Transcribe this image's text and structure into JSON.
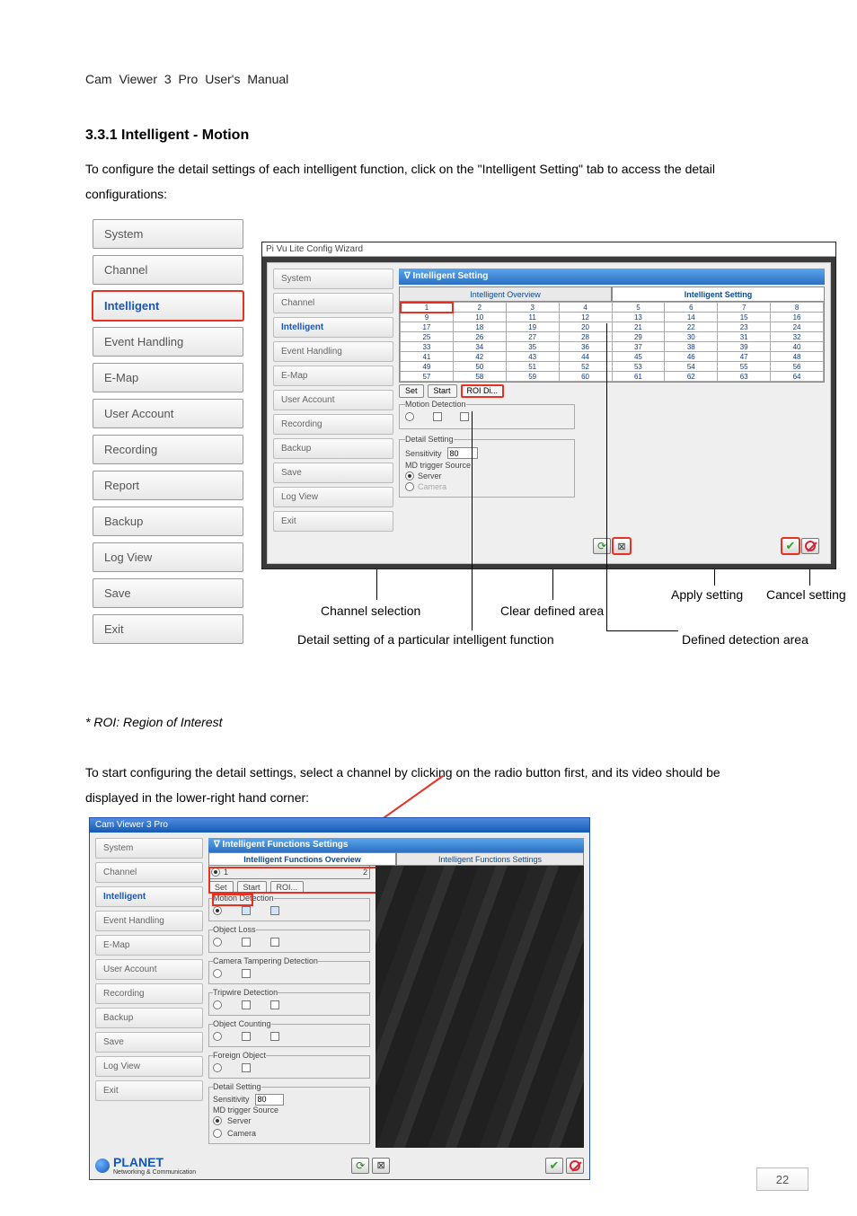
{
  "running_header": "Cam  Viewer  3  Pro  User's  Manual",
  "section_title": "3.3.1 Intelligent - Motion",
  "paragraph1": "To configure the detail settings of each intelligent function, click on the \"Intelligent Setting\" tab to access the detail configurations:",
  "roi_note": "* ROI: Region of Interest",
  "paragraph2": "To start configuring the detail settings, select a channel by clicking on the radio button first, and its video should be displayed in the lower-right hand corner:",
  "page_number": "22",
  "left_menu": {
    "items": [
      "System",
      "Channel",
      "Intelligent",
      "Event Handling",
      "E-Map",
      "User Account",
      "Recording",
      "Report",
      "Backup",
      "Log View",
      "Save",
      "Exit"
    ],
    "active_index": 2,
    "outlined_index": 2
  },
  "mini_menu": {
    "items": [
      "System",
      "Channel",
      "Intelligent",
      "Event Handling",
      "E-Map",
      "User Account",
      "Recording",
      "Backup",
      "Save",
      "Log View",
      "Exit"
    ],
    "active_index": 2
  },
  "wizard": {
    "window_title": "Pi Vu Lite Config Wizard",
    "panel_title": "∇ Intelligent Setting",
    "tabs": {
      "left": "Intelligent Overview",
      "right": "Intelligent Setting",
      "active": "right"
    },
    "channel_grid": {
      "cols": 8,
      "rows": 8,
      "values": [
        [
          1,
          2,
          3,
          4,
          5,
          6,
          7,
          8
        ],
        [
          9,
          10,
          11,
          12,
          13,
          14,
          15,
          16
        ],
        [
          17,
          18,
          19,
          20,
          21,
          22,
          23,
          24
        ],
        [
          25,
          26,
          27,
          28,
          29,
          30,
          31,
          32
        ],
        [
          33,
          34,
          35,
          36,
          37,
          38,
          39,
          40
        ],
        [
          41,
          42,
          43,
          44,
          45,
          46,
          47,
          48
        ],
        [
          49,
          50,
          51,
          52,
          53,
          54,
          55,
          56
        ],
        [
          57,
          58,
          59,
          60,
          61,
          62,
          63,
          64
        ]
      ],
      "outlined_cell": [
        0,
        0
      ]
    },
    "buttons": {
      "set": "Set",
      "start": "Start",
      "roi": "ROI Di..."
    },
    "motion_detection_label": "Motion Detection",
    "detail_setting": {
      "legend": "Detail Setting",
      "sensitivity_label": "Sensitivity",
      "sensitivity_value": "80",
      "trigger_label": "MD trigger Source",
      "server_label": "Server",
      "camera_label": "Camera"
    },
    "callouts": {
      "channel_selection": "Channel selection",
      "clear_defined_area": "Clear defined area",
      "apply_setting": "Apply setting",
      "cancel_setting": "Cancel setting",
      "detail_particular": "Detail setting of a particular intelligent function",
      "defined_area": "Defined detection area"
    }
  },
  "dialog2": {
    "title": "Cam Viewer 3 Pro",
    "panel_title": "∇ Intelligent Functions Settings",
    "tabs": {
      "left": "Intelligent Functions Overview",
      "right": "Intelligent Functions Settings",
      "active": "left"
    },
    "channels": [
      "1",
      "2"
    ],
    "row2_buttons": {
      "set": "Set",
      "start": "Start",
      "roi": "ROI..."
    },
    "blocks": {
      "motion": {
        "label": "Motion Detection",
        "radio": true,
        "check1": true,
        "check2": true
      },
      "loss": {
        "label": "Object Loss",
        "radio": false,
        "check1": false,
        "check2": false
      },
      "tamper": {
        "label": "Camera Tampering Detection",
        "radio": false,
        "check1": false
      },
      "trip": {
        "label": "Tripwire Detection",
        "radio": false,
        "check1": false,
        "check2": false
      },
      "count": {
        "label": "Object Counting",
        "radio": false,
        "check1": false,
        "check2": false
      },
      "foreign": {
        "label": "Foreign Object",
        "radio": false,
        "check1": false
      }
    },
    "detail_setting": {
      "legend": "Detail Setting",
      "sensitivity_label": "Sensitivity",
      "sensitivity_value": "80",
      "trigger_label": "MD trigger Source",
      "server_label": "Server",
      "camera_label": "Camera"
    },
    "brand": {
      "name": "PLANET",
      "tagline": "Networking & Communication"
    }
  }
}
